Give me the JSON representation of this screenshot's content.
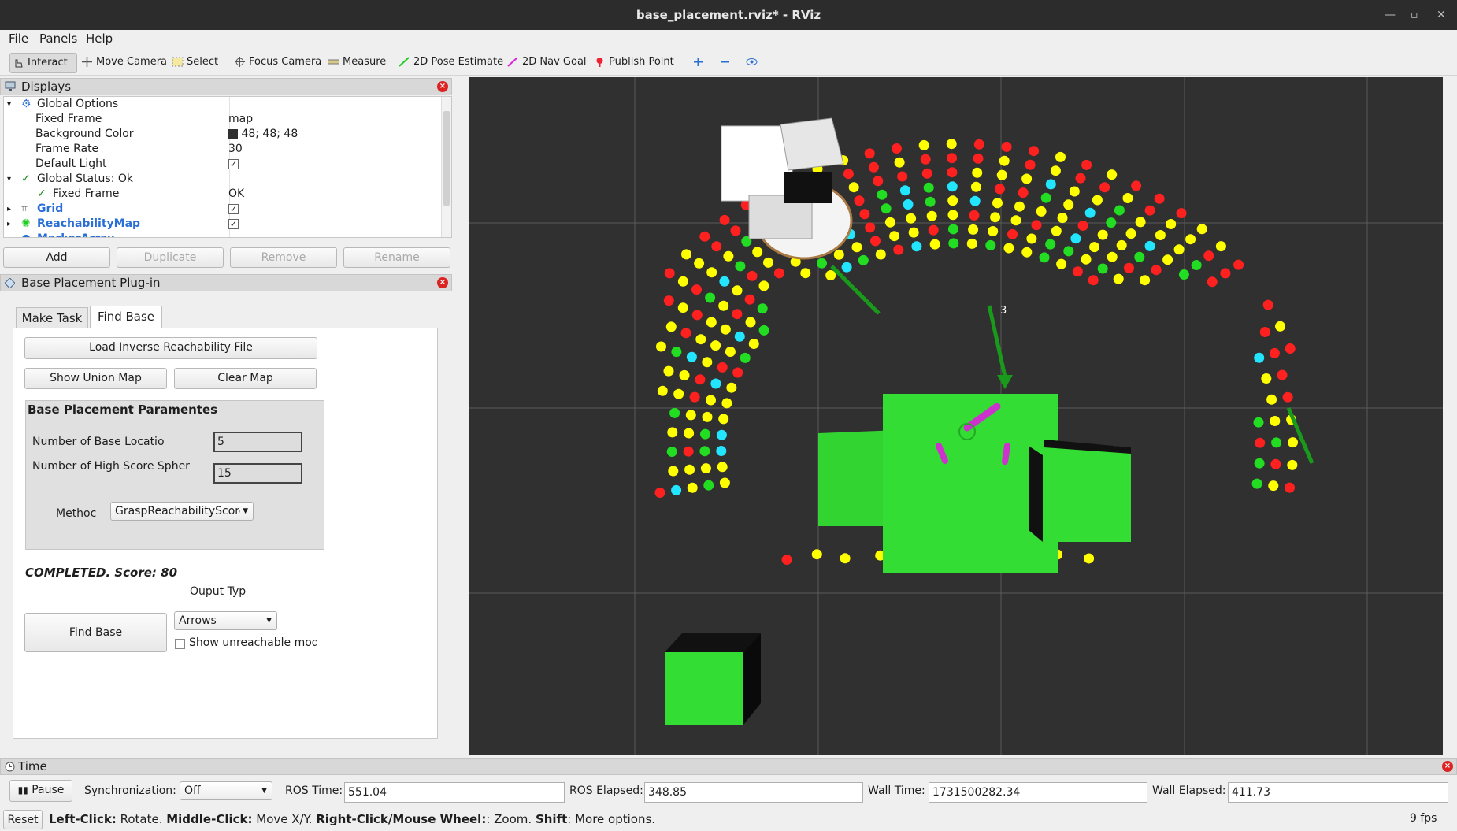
{
  "window": {
    "title": "base_placement.rviz* - RViz"
  },
  "menu": [
    "File",
    "Panels",
    "Help"
  ],
  "toolbar": {
    "interact": "Interact",
    "move_camera": "Move Camera",
    "select": "Select",
    "focus_camera": "Focus Camera",
    "measure": "Measure",
    "pose_estimate": "2D Pose Estimate",
    "nav_goal": "2D Nav Goal",
    "publish_point": "Publish Point"
  },
  "displays": {
    "title": "Displays",
    "rows": [
      {
        "key": "Global Options",
        "value": ""
      },
      {
        "key": "Fixed Frame",
        "value": "map"
      },
      {
        "key": "Background Color",
        "value": "48; 48; 48"
      },
      {
        "key": "Frame Rate",
        "value": "30"
      },
      {
        "key": "Default Light",
        "value": ""
      },
      {
        "key": "Global Status: Ok",
        "value": ""
      },
      {
        "key": "Fixed Frame",
        "value": "OK"
      },
      {
        "key": "Grid",
        "value": ""
      },
      {
        "key": "ReachabilityMap",
        "value": ""
      },
      {
        "key": "MarkerArray",
        "value": ""
      }
    ],
    "add": "Add",
    "duplicate": "Duplicate",
    "remove": "Remove",
    "rename": "Rename"
  },
  "plugin": {
    "title": "Base Placement Plug-in",
    "tabs": [
      "Make Task",
      "Find Base"
    ],
    "load_button": "Load Inverse Reachability File",
    "union_button": "Show Union Map",
    "clear_button": "Clear Map",
    "params_title": "Base Placement Paramentes",
    "num_base_label": "Number of Base Locatio",
    "num_base_value": "5",
    "num_high_label": "Number of High Score Spher",
    "num_high_value": "15",
    "method_label": "Methoc",
    "method_value": "GraspReachabilityScore",
    "completed": "COMPLETED. Score: 80",
    "output_label": "Ouput Typ",
    "output_value": "Arrows",
    "find_button": "Find Base",
    "show_unreachable": "Show unreachable mode"
  },
  "time": {
    "title": "Time",
    "pause": "Pause",
    "sync_label": "Synchronization:",
    "sync_value": "Off",
    "ros_time_label": "ROS Time:",
    "ros_time": "551.04",
    "ros_elapsed_label": "ROS Elapsed:",
    "ros_elapsed": "348.85",
    "wall_time_label": "Wall Time:",
    "wall_time": "1731500282.34",
    "wall_elapsed_label": "Wall Elapsed:",
    "wall_elapsed": "411.73"
  },
  "status": {
    "reset": "Reset",
    "hint_1_bold": "Left-Click:",
    "hint_1": " Rotate. ",
    "hint_2_bold": "Middle-Click:",
    "hint_2": " Move X/Y. ",
    "hint_3_bold": "Right-Click/Mouse Wheel:",
    "hint_3": ": Zoom. ",
    "hint_4_bold": "Shift",
    "hint_4": ": More options.",
    "fps": "9 fps"
  },
  "viewport": {
    "marker_label": "3",
    "background": "#303030"
  },
  "colors": {
    "red": "#ff2020",
    "yellow": "#ffff00",
    "green": "#22dd22",
    "cyan": "#22e5ff",
    "table": "#33dd33"
  }
}
